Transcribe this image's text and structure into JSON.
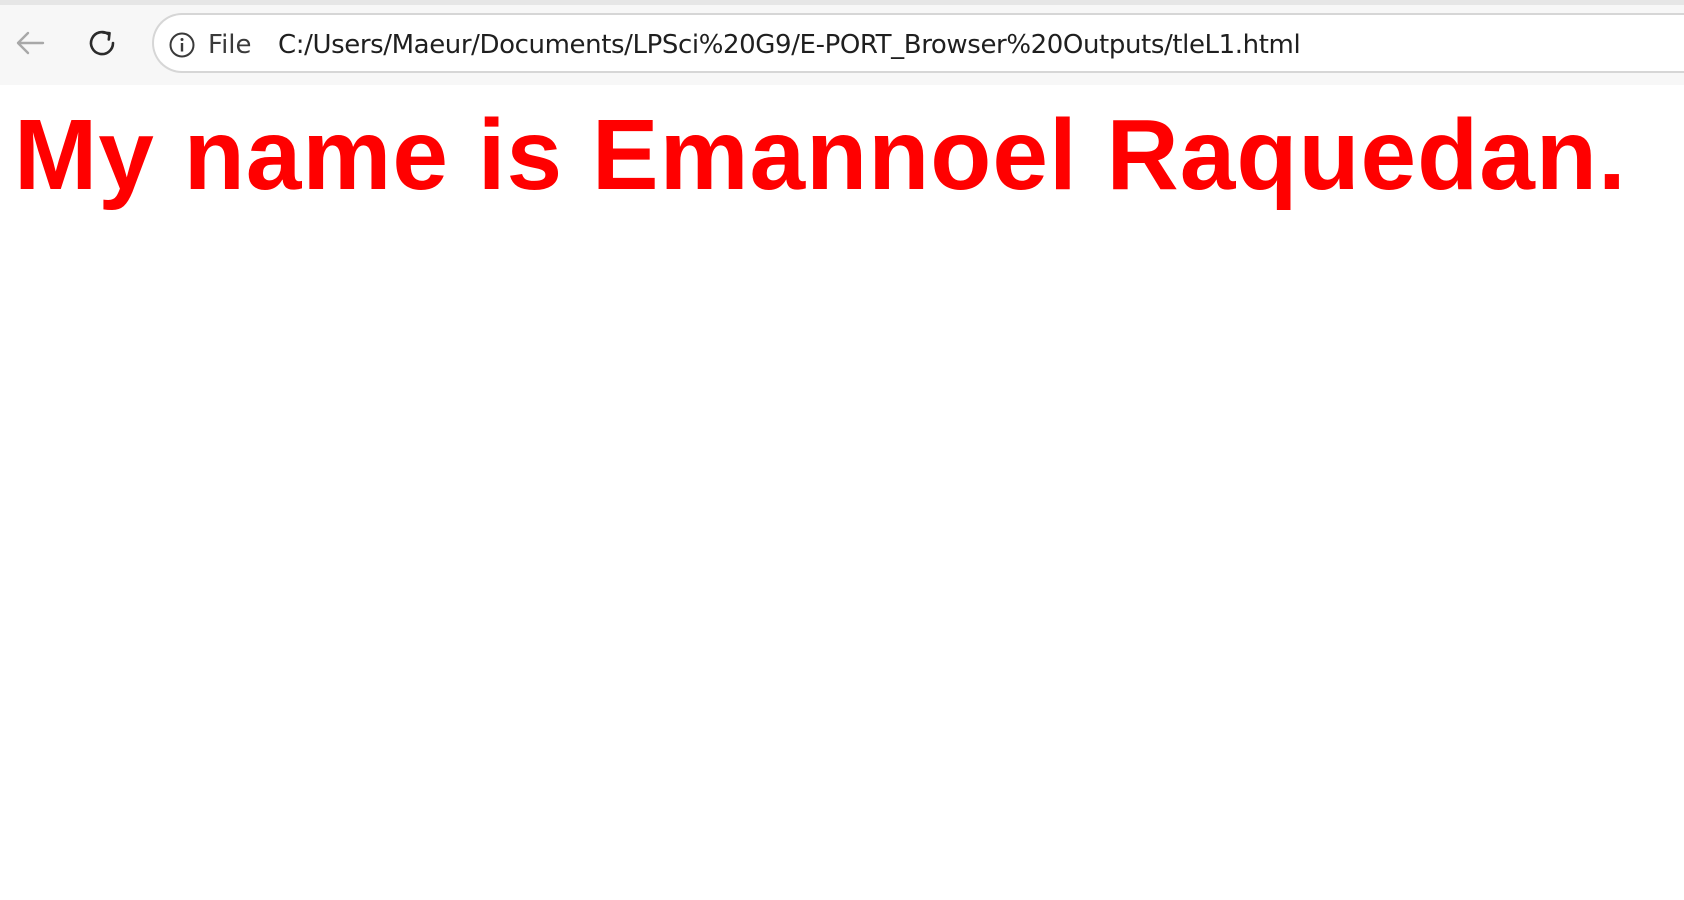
{
  "browser": {
    "address_bar": {
      "scheme_label": "File",
      "url": "C:/Users/Maeur/Documents/LPSci%20G9/E-PORT_Browser%20Outputs/tleL1.html"
    },
    "icons": {
      "back": "back-arrow-icon",
      "reload": "reload-icon",
      "info": "info-icon"
    }
  },
  "page": {
    "heading": "My name is Emannoel Raquedan.",
    "heading_color": "#ff0000"
  }
}
